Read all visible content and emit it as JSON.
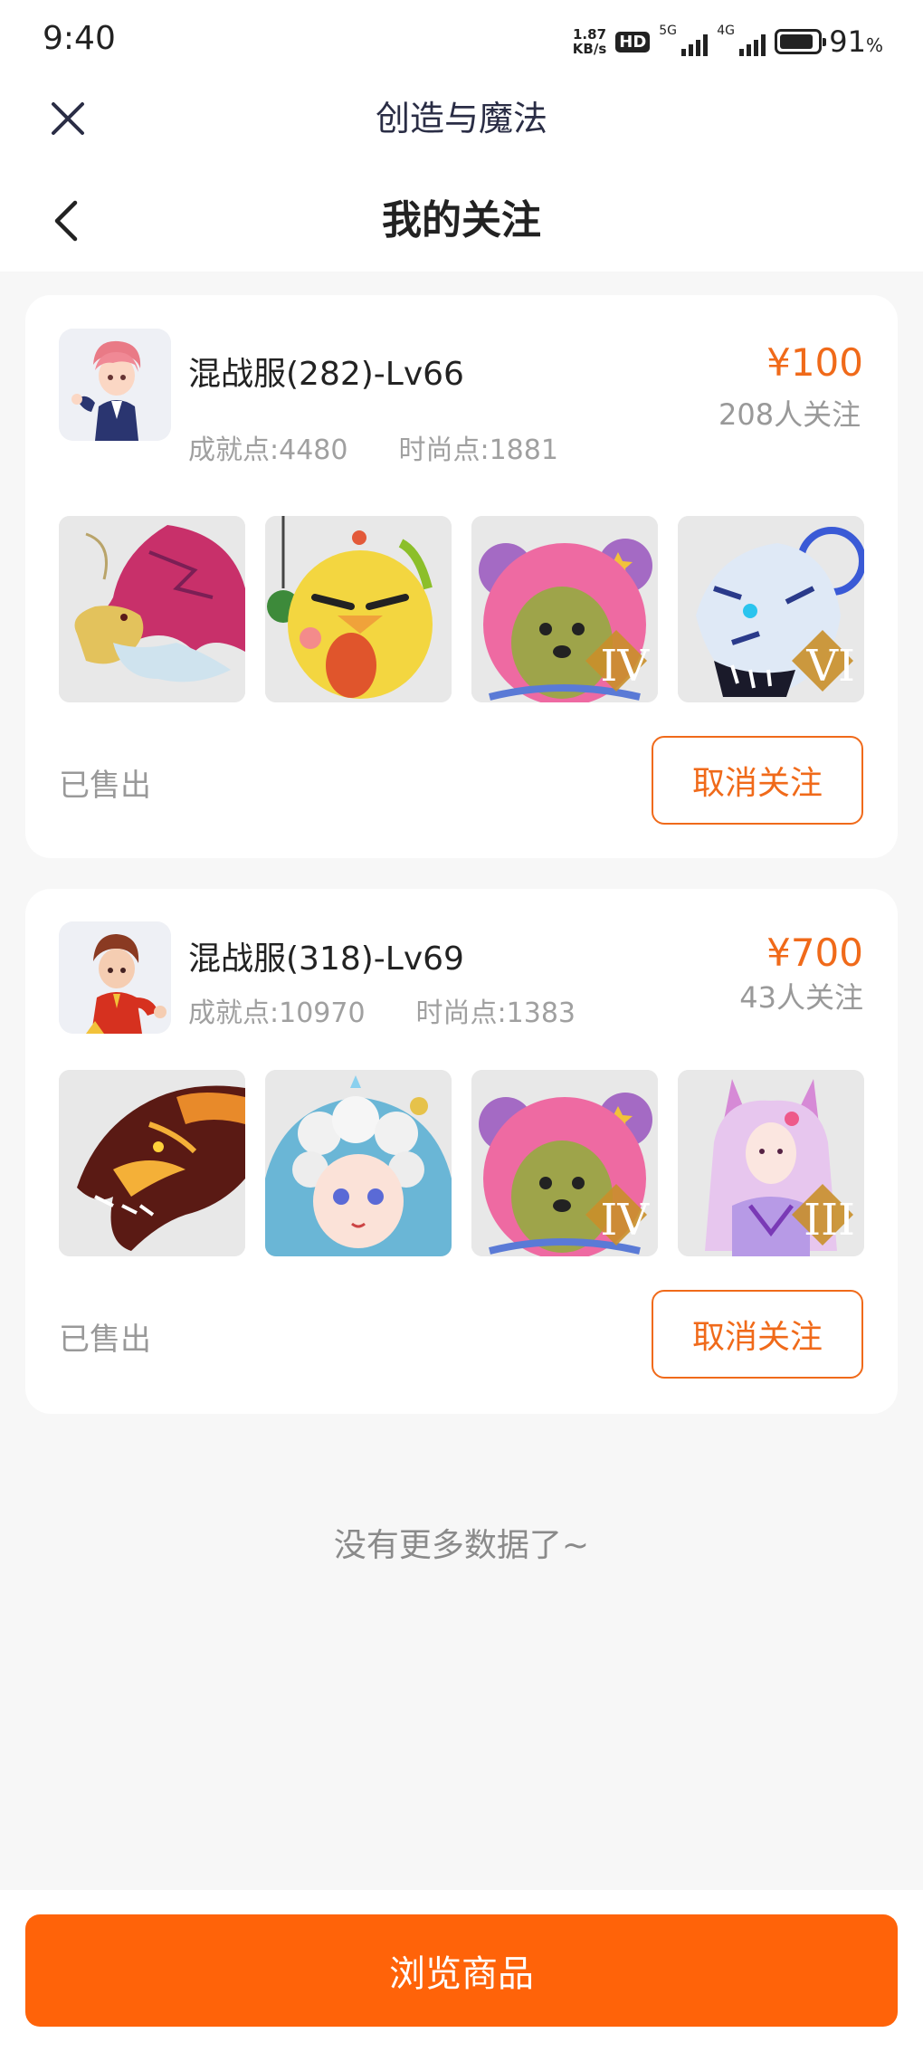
{
  "status_bar": {
    "time": "9:40",
    "speed_value": "1.87",
    "speed_unit": "KB/s",
    "hd_label": "HD",
    "net1_label": "5G",
    "net2_label": "4G",
    "battery_percent": "91",
    "battery_unit": "%",
    "battery_level": 0.91
  },
  "app_header": {
    "title": "创造与魔法",
    "close_icon": "close-icon"
  },
  "nav": {
    "title": "我的关注",
    "back_icon": "chevron-left-icon"
  },
  "accounts": [
    {
      "name": "混战服(282)-Lv66",
      "achievement": "成就点:4480",
      "fashion": "时尚点:1881",
      "price": "¥100",
      "followers": "208人关注",
      "status": "已售出",
      "unfollow_label": "取消关注",
      "items": [
        {
          "icon": "dragon-mount-icon",
          "badge": ""
        },
        {
          "icon": "chick-pet-icon",
          "badge": ""
        },
        {
          "icon": "pink-bear-icon",
          "badge": "IV"
        },
        {
          "icon": "ice-tiger-icon",
          "badge": "VI"
        }
      ]
    },
    {
      "name": "混战服(318)-Lv69",
      "achievement": "成就点:10970",
      "fashion": "时尚点:1383",
      "price": "¥700",
      "followers": "43人关注",
      "status": "已售出",
      "unfollow_label": "取消关注",
      "items": [
        {
          "icon": "fire-dragon-icon",
          "badge": ""
        },
        {
          "icon": "cloud-sheep-icon",
          "badge": ""
        },
        {
          "icon": "pink-bear-icon",
          "badge": "IV"
        },
        {
          "icon": "fox-fairy-icon",
          "badge": "III"
        }
      ]
    }
  ],
  "footer_note": "没有更多数据了~",
  "browse_button": "浏览商品",
  "colors": {
    "accent": "#ff6309",
    "price": "#f06a1a",
    "muted": "#999999"
  }
}
